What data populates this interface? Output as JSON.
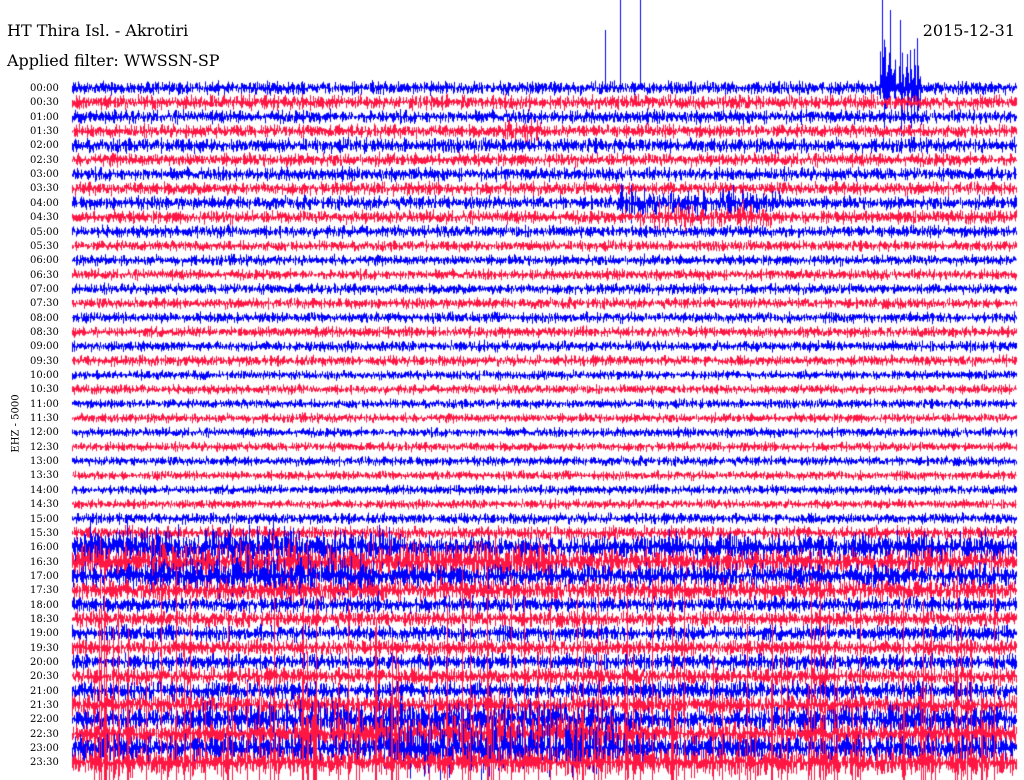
{
  "header": {
    "station": "HT Thira Isl. - Akrotiri",
    "filter": "Applied filter: WWSSN-SP",
    "date": "2015-12-31",
    "channel": "EHZ - 5000"
  },
  "colors": {
    "trace_a": "#0000ff",
    "trace_b": "#ff1744",
    "background": "#ffffff",
    "text": "#000000"
  },
  "chart_data": {
    "type": "line",
    "title": "HT Thira Isl. - Akrotiri",
    "subtitle": "Applied filter: WWSSN-SP",
    "ylabel": "EHZ - 5000",
    "date": "2015-12-31",
    "row_labels": [
      "00:00",
      "00:30",
      "01:00",
      "01:30",
      "02:00",
      "02:30",
      "03:00",
      "03:30",
      "04:00",
      "04:30",
      "05:00",
      "05:30",
      "06:00",
      "06:30",
      "07:00",
      "07:30",
      "08:00",
      "08:30",
      "09:00",
      "09:30",
      "10:00",
      "10:30",
      "11:00",
      "11:30",
      "12:00",
      "12:30",
      "13:00",
      "13:30",
      "14:00",
      "14:30",
      "15:00",
      "15:30",
      "16:00",
      "16:30",
      "17:00",
      "17:30",
      "18:00",
      "18:30",
      "19:00",
      "19:30",
      "20:00",
      "20:30",
      "21:00",
      "21:30",
      "22:00",
      "22:30",
      "23:00",
      "23:30"
    ],
    "row_colors": "alternating blue (even rows) / red (odd rows)",
    "relative_amplitude": [
      1.0,
      1.1,
      1.0,
      1.0,
      1.1,
      1.0,
      1.0,
      1.0,
      1.0,
      1.0,
      0.9,
      0.8,
      0.8,
      0.8,
      0.8,
      0.8,
      0.8,
      0.8,
      0.8,
      0.8,
      0.7,
      0.7,
      0.7,
      0.7,
      0.7,
      0.7,
      0.7,
      0.7,
      0.7,
      0.7,
      0.8,
      1.0,
      1.6,
      1.8,
      1.8,
      1.6,
      1.2,
      1.2,
      1.2,
      1.2,
      1.2,
      1.3,
      1.4,
      1.5,
      1.6,
      1.8,
      2.0,
      2.0
    ],
    "notable_events": [
      {
        "row": "00:00",
        "position": "far right",
        "description": "large spikes"
      },
      {
        "row": "01:30",
        "position": "middle",
        "description": "burst"
      },
      {
        "row": "04:00",
        "position": "right of middle",
        "description": "large burst"
      },
      {
        "row": "16:00",
        "position": "left",
        "description": "large burst"
      },
      {
        "row": "22:00",
        "position": "across",
        "description": "large spikes"
      }
    ],
    "grid": false,
    "legend": "none"
  }
}
